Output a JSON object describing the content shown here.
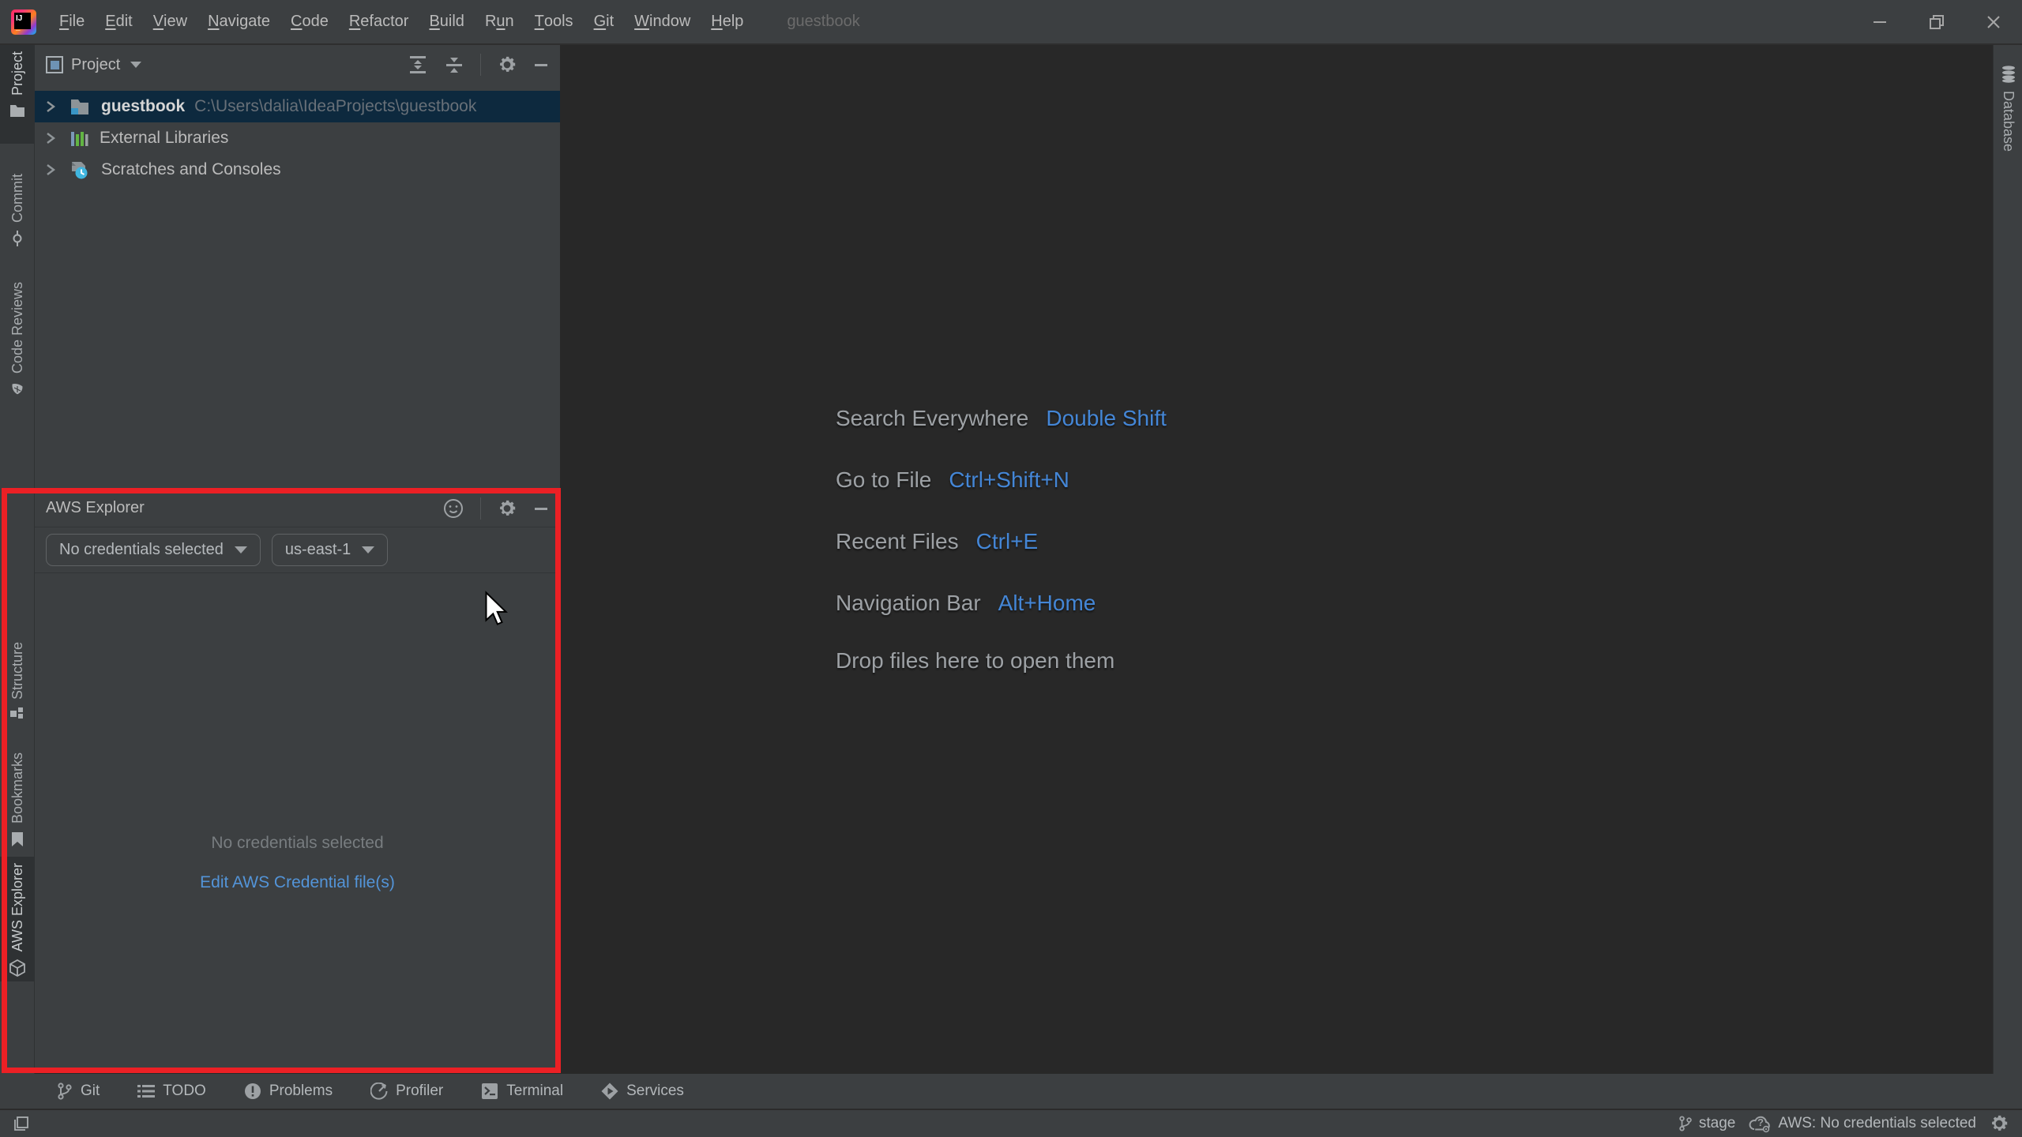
{
  "window": {
    "title": "guestbook"
  },
  "menubar": {
    "items": [
      {
        "pre": "",
        "mn": "F",
        "rest": "ile"
      },
      {
        "pre": "",
        "mn": "E",
        "rest": "dit"
      },
      {
        "pre": "",
        "mn": "V",
        "rest": "iew"
      },
      {
        "pre": "",
        "mn": "N",
        "rest": "avigate"
      },
      {
        "pre": "",
        "mn": "C",
        "rest": "ode"
      },
      {
        "pre": "",
        "mn": "R",
        "rest": "efactor"
      },
      {
        "pre": "",
        "mn": "B",
        "rest": "uild"
      },
      {
        "pre": "R",
        "mn": "u",
        "rest": "n"
      },
      {
        "pre": "",
        "mn": "T",
        "rest": "ools"
      },
      {
        "pre": "",
        "mn": "G",
        "rest": "it"
      },
      {
        "pre": "",
        "mn": "W",
        "rest": "indow"
      },
      {
        "pre": "",
        "mn": "H",
        "rest": "elp"
      }
    ]
  },
  "left_stripe": {
    "tabs": [
      {
        "label": "Project"
      },
      {
        "label": "Commit"
      },
      {
        "label": "Code Reviews"
      },
      {
        "label": "Structure"
      },
      {
        "label": "Bookmarks"
      },
      {
        "label": "AWS Explorer"
      }
    ]
  },
  "right_stripe": {
    "tabs": [
      {
        "label": "Database"
      }
    ]
  },
  "project_panel": {
    "title": "Project",
    "tree": {
      "rows": [
        {
          "label": "guestbook",
          "path": "C:\\Users\\dalia\\IdeaProjects\\guestbook"
        },
        {
          "label": "External Libraries"
        },
        {
          "label": "Scratches and Consoles"
        }
      ]
    }
  },
  "aws_panel": {
    "title": "AWS Explorer",
    "credentials_selector": "No credentials selected",
    "region_selector": "us-east-1",
    "empty_message": "No credentials selected",
    "credentials_link": "Edit AWS Credential file(s)"
  },
  "editor": {
    "shortcuts": [
      {
        "label": "Search Everywhere",
        "keys": "Double Shift"
      },
      {
        "label": "Go to File",
        "keys": "Ctrl+Shift+N"
      },
      {
        "label": "Recent Files",
        "keys": "Ctrl+E"
      },
      {
        "label": "Navigation Bar",
        "keys": "Alt+Home"
      }
    ],
    "drop_hint": "Drop files here to open them"
  },
  "bottom_toolbar": {
    "items": [
      {
        "label": "Git"
      },
      {
        "label": "TODO"
      },
      {
        "label": "Problems"
      },
      {
        "label": "Profiler"
      },
      {
        "label": "Terminal"
      },
      {
        "label": "Services"
      }
    ]
  },
  "status_bar": {
    "branch": "stage",
    "aws_status": "AWS: No credentials selected"
  },
  "colors": {
    "panel_bg": "#3c3f41",
    "editor_bg": "#282828",
    "selection_bg": "#0d293e",
    "shortcut_blue": "#4486d6",
    "link_blue": "#5394d8",
    "highlight_red": "#ec2025",
    "text": "#bbbbbb",
    "dim_text": "#787d80"
  }
}
